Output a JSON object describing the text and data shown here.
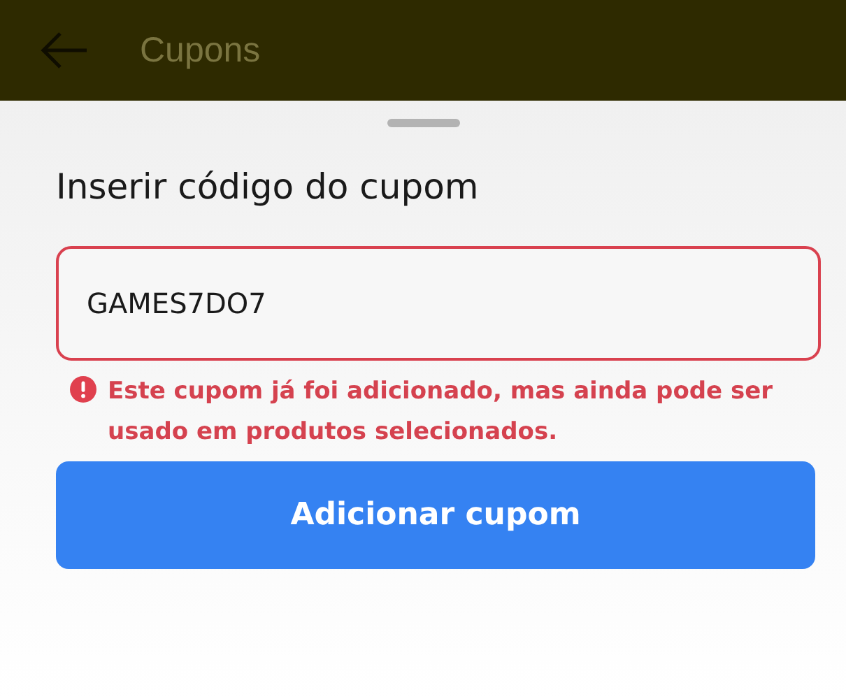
{
  "app_bar": {
    "title": "Cupons"
  },
  "sheet": {
    "title": "Inserir código do cupom",
    "coupon_field": {
      "value": "GAMES7DO7",
      "invalid": true
    },
    "error_message": "Este cupom já foi adicionado, mas ainda pode ser usado em produtos selecionados.",
    "button": "Adicionar cupom"
  }
}
